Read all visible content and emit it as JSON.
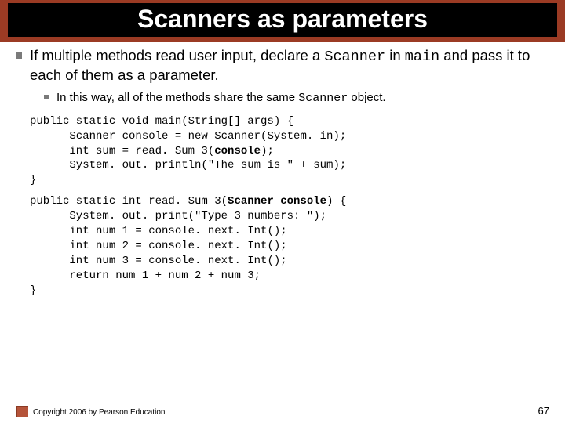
{
  "title": "Scanners as parameters",
  "bullet1_pre": "If multiple methods read user input, declare a ",
  "bullet1_code1": "Scanner",
  "bullet1_mid": " in ",
  "bullet1_code2": "main",
  "bullet1_post": " and pass it to each of them as a parameter.",
  "sub_pre": "In this way, all of the methods share the same ",
  "sub_code": "Scanner",
  "sub_post": " object.",
  "code1": "public static void main(String[] args) {\n      Scanner console = new Scanner(System. in);\n      int sum = read. Sum 3(console);\n      System. out. println(\"The sum is \" + sum);\n}",
  "code2": "public static int read. Sum 3(Scanner console) {\n      System. out. print(\"Type 3 numbers: \");\n      int num 1 = console. next. Int();\n      int num 2 = console. next. Int();\n      int num 3 = console. next. Int();\n      return num 1 + num 2 + num 3;\n}",
  "code2_bold_frag": "Scanner console",
  "code1_bold_frag": "console",
  "copyright": "Copyright 2006 by Pearson Education",
  "page": "67"
}
